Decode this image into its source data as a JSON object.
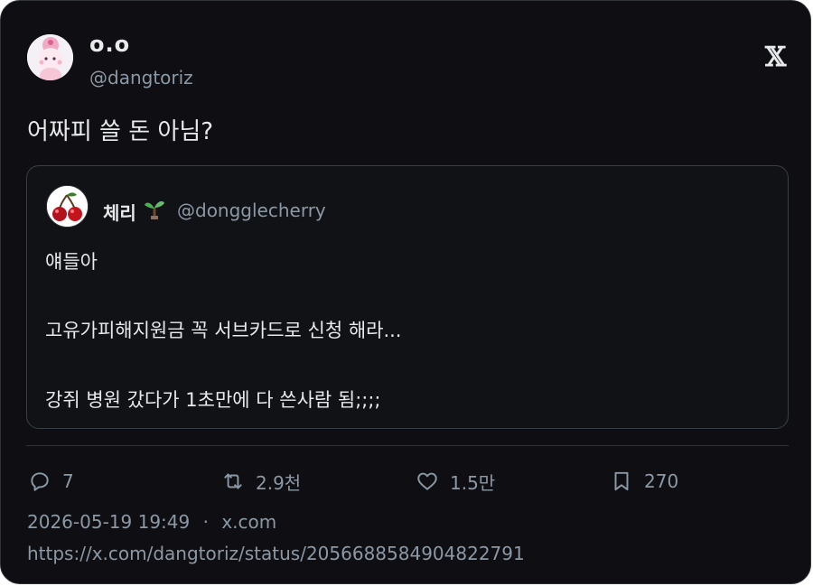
{
  "tweet": {
    "display_name": "o.o",
    "handle": "@dangtoriz",
    "text": "어짜피 쓸 돈 아님?",
    "x_logo": "𝕏",
    "avatar_icon": "pink-character-avatar"
  },
  "quote": {
    "display_name": "체리",
    "name_emoji": "sprout-icon",
    "handle": "@dongglecherry",
    "avatar_icon": "cherry-avatar",
    "lines": [
      "얘들아",
      "고유가피해지원금 꼭 서브카드로 신청 해라...",
      "강쥐 병원 갔다가 1초만에 다 쓴사람 됨;;;;"
    ]
  },
  "actions": {
    "reply": {
      "icon": "reply-icon",
      "count": "7"
    },
    "retweet": {
      "icon": "retweet-icon",
      "count": "2.9천"
    },
    "like": {
      "icon": "heart-icon",
      "count": "1.5만"
    },
    "bookmark": {
      "icon": "bookmark-icon",
      "count": "270"
    }
  },
  "meta": {
    "datetime": "2026-05-19 19:49",
    "separator": "·",
    "source": "x.com",
    "url": "https://x.com/dangtoriz/status/2056688584904822791"
  },
  "colors": {
    "background": "#0f0f13",
    "text": "#e7e9ea",
    "muted": "#8b98a5",
    "border": "#2f3336"
  }
}
